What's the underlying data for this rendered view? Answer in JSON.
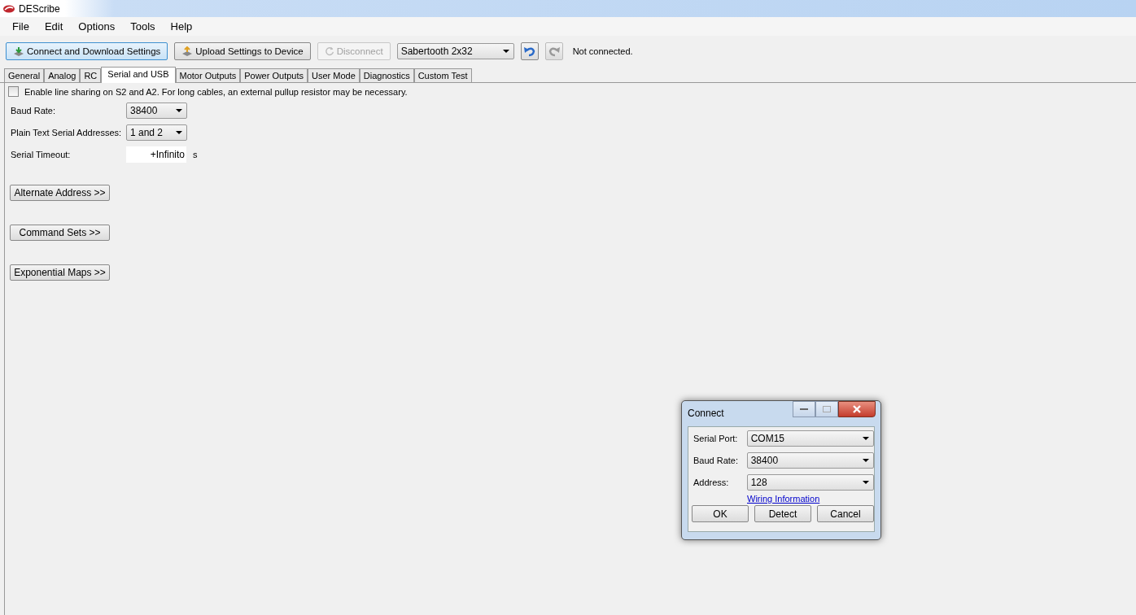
{
  "window": {
    "title": "DEScribe"
  },
  "menu": [
    "File",
    "Edit",
    "Options",
    "Tools",
    "Help"
  ],
  "toolbar": {
    "buttons": [
      {
        "label": "Connect and Download Settings",
        "disabled": false,
        "kind": "download"
      },
      {
        "label": "Upload Settings to Device",
        "disabled": false,
        "kind": "upload"
      },
      {
        "label": "Disconnect",
        "disabled": true,
        "kind": "refresh"
      }
    ],
    "device": "Sabertooth 2x32",
    "undo_enabled": true,
    "redo_enabled": false,
    "status": "Not connected."
  },
  "tabs": [
    {
      "label": "General",
      "selected": false
    },
    {
      "label": "Analog",
      "selected": false
    },
    {
      "label": "RC",
      "selected": false
    },
    {
      "label": "Serial and USB",
      "selected": true
    },
    {
      "label": "Motor Outputs",
      "selected": false
    },
    {
      "label": "Power Outputs",
      "selected": false
    },
    {
      "label": "User Mode",
      "selected": false
    },
    {
      "label": "Diagnostics",
      "selected": false
    },
    {
      "label": "Custom Test",
      "selected": false
    }
  ],
  "line_sharing": {
    "label": "Enable line sharing on S2 and A2. For long cables, an external pullup resistor may be necessary.",
    "checked": false
  },
  "fields": [
    {
      "label": "Baud Rate:",
      "kind": "dropdown",
      "value": "38400"
    },
    {
      "label": "Plain Text Serial Addresses:",
      "kind": "dropdown",
      "value": "1 and 2"
    },
    {
      "label": "Serial Timeout:",
      "kind": "input",
      "value": "+Infinito",
      "unit": "s"
    }
  ],
  "section_buttons": [
    "Alternate Address >>",
    "Command Sets >>",
    "Exponential Maps >>"
  ],
  "dialog": {
    "title": "Connect",
    "fields": [
      {
        "label": "Serial Port:",
        "value": "COM15"
      },
      {
        "label": "Baud Rate:",
        "value": "38400"
      },
      {
        "label": "Address:",
        "value": "128"
      }
    ],
    "link": "Wiring Information",
    "buttons": [
      "OK",
      "Detect",
      "Cancel"
    ]
  }
}
